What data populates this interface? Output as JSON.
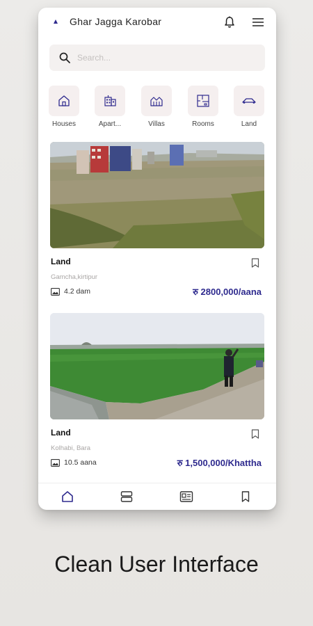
{
  "app": {
    "title": "Ghar Jagga Karobar",
    "accent_color": "#2e2a8e",
    "icons": {
      "logo": "logo-mark",
      "notifications": "bell-icon",
      "menu": "hamburger-menu-icon"
    }
  },
  "search": {
    "placeholder": "Search...",
    "value": "",
    "icon": "search-icon"
  },
  "categories": [
    {
      "label": "Houses",
      "icon": "house-icon"
    },
    {
      "label": "Apart...",
      "icon": "apartment-icon"
    },
    {
      "label": "Villas",
      "icon": "villa-icon"
    },
    {
      "label": "Rooms",
      "icon": "floorplan-icon"
    },
    {
      "label": "Land",
      "icon": "land-icon"
    }
  ],
  "listings": [
    {
      "title": "Land",
      "location": "Gamcha,kirtipur",
      "area": "4.2 dam",
      "price": "रु 2800,000/aana",
      "image": "open land plot with buildings in the distance",
      "saved": false
    },
    {
      "title": "Land",
      "location": "Kolhabi, Bara",
      "area": "10.5 aana",
      "price": "रु 1,500,000/Khattha",
      "image": "green rice field with a person standing on a path",
      "saved": false
    }
  ],
  "bottom_nav": [
    {
      "icon": "home-icon",
      "active": true
    },
    {
      "icon": "stack-icon",
      "active": false
    },
    {
      "icon": "id-card-icon",
      "active": false
    },
    {
      "icon": "bookmark-icon",
      "active": false
    }
  ],
  "tagline": "Clean User Interface"
}
